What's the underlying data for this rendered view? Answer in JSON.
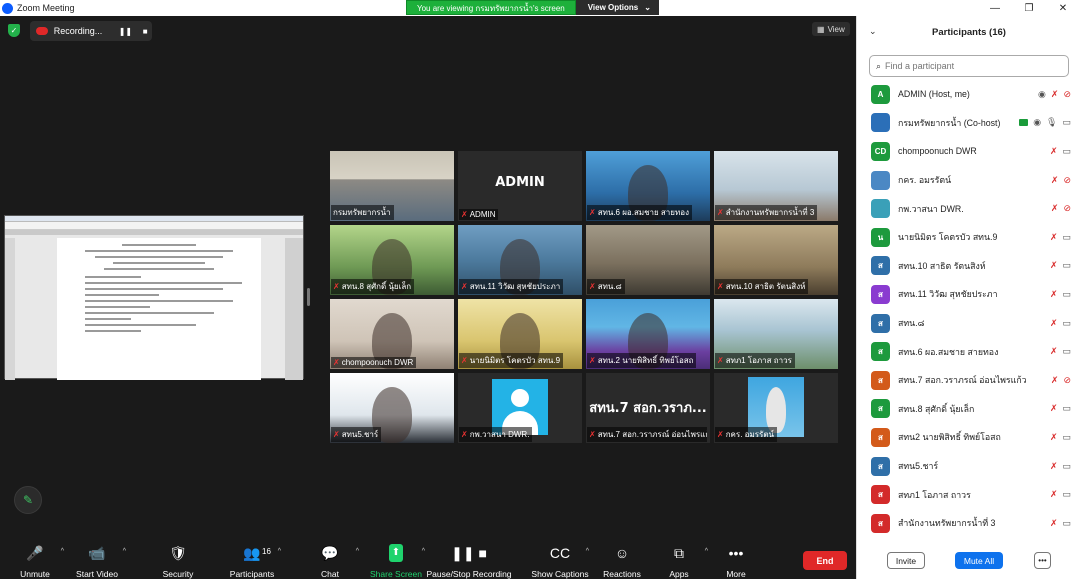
{
  "window": {
    "title": "Zoom Meeting",
    "controls": [
      "—",
      "❐",
      "✕"
    ]
  },
  "share_banner": {
    "message": "You are viewing กรมทรัพยากรน้ำ's screen",
    "options_label": "View Options",
    "options_caret": "⌄"
  },
  "recording": {
    "label": "Recording...",
    "pause_icon": "❚❚",
    "stop_icon": "■"
  },
  "view_button": {
    "icon": "▦",
    "label": "View"
  },
  "video_tiles": [
    {
      "name": "กรมทรัพยากรน้ำ",
      "muted": false,
      "active": true,
      "scene": "meeting-room"
    },
    {
      "name": "ADMIN",
      "muted": true,
      "active": false,
      "scene": "text",
      "big_text": "ADMIN"
    },
    {
      "name": "สทน.6 ผอ.สมชาย สายทอง",
      "muted": true,
      "active": false,
      "scene": "person-blue"
    },
    {
      "name": "สำนักงานทรัพยากรน้ำที่ 3",
      "muted": true,
      "active": false,
      "scene": "office"
    },
    {
      "name": "สทน.8 สุศักดิ์ นุ้ยเล็ก",
      "muted": true,
      "active": false,
      "scene": "person-green"
    },
    {
      "name": "สทน.11 วิวัฒ สุหชัยประภา",
      "muted": true,
      "active": false,
      "scene": "person-lake"
    },
    {
      "name": "สทน.๘",
      "muted": true,
      "active": false,
      "scene": "room"
    },
    {
      "name": "สทน.10 สาธิต รัตนสิงห์",
      "muted": true,
      "active": false,
      "scene": "office2"
    },
    {
      "name": "chompoonuch DWR",
      "muted": true,
      "active": false,
      "scene": "person-female"
    },
    {
      "name": "นายนิมิตร โคตรบัว สทน.9",
      "muted": true,
      "active": false,
      "scene": "person-yellow"
    },
    {
      "name": "สทน.2 นายพิสิทธิ์ ทิพย์โอสถ",
      "muted": true,
      "active": false,
      "scene": "person-purple"
    },
    {
      "name": "สทภ1 โอภาส ถาวร",
      "muted": true,
      "active": false,
      "scene": "aerial"
    },
    {
      "name": "สทน5.ชาร์",
      "muted": true,
      "active": false,
      "scene": "person-dark"
    },
    {
      "name": "กพ.วาสนา DWR.",
      "muted": true,
      "active": false,
      "scene": "avatar"
    },
    {
      "name": "สทน.7 สอก.วราภรณ์ อ่อนไพรแก้ว",
      "muted": true,
      "active": false,
      "scene": "text",
      "big_text": "สทน.7 สอก.วราภ..."
    },
    {
      "name": "กคร. อมรรัตน์",
      "muted": true,
      "active": false,
      "scene": "person-photo"
    }
  ],
  "toolbar": {
    "items": [
      {
        "key": "unmute",
        "label": "Unmute",
        "icon": "🎤",
        "caret": "^"
      },
      {
        "key": "start-video",
        "label": "Start Video",
        "icon": "📹",
        "caret": "^"
      },
      {
        "key": "security",
        "label": "Security",
        "icon": "🛡",
        "caret": ""
      },
      {
        "key": "participants",
        "label": "Participants",
        "icon": "👥",
        "count": "16",
        "caret": "^"
      },
      {
        "key": "chat",
        "label": "Chat",
        "icon": "💬",
        "caret": "^"
      },
      {
        "key": "share-screen",
        "label": "Share Screen",
        "icon": "⬆",
        "caret": "^"
      },
      {
        "key": "pause-stop-recording",
        "label": "Pause/Stop Recording",
        "icon": "❚❚ ■",
        "caret": ""
      },
      {
        "key": "show-captions",
        "label": "Show Captions",
        "icon": "CC",
        "caret": "^"
      },
      {
        "key": "reactions",
        "label": "Reactions",
        "icon": "☺",
        "caret": ""
      },
      {
        "key": "apps",
        "label": "Apps",
        "icon": "⧉",
        "caret": "^"
      },
      {
        "key": "more",
        "label": "More",
        "icon": "•••",
        "caret": ""
      }
    ],
    "end_label": "End"
  },
  "participants_panel": {
    "title": "Participants (16)",
    "search_placeholder": "Find a participant",
    "participants": [
      {
        "initials": "A",
        "name": "ADMIN (Host, me)",
        "color": "#1d9a3d",
        "mic": "off",
        "cam": "off",
        "rec": true,
        "cohost": false
      },
      {
        "initials": "",
        "name": "กรมทรัพยากรน้ำ (Co-host)",
        "color": "#2b6fb8",
        "mic": "on",
        "cam": "on",
        "rec": true,
        "cohost": true
      },
      {
        "initials": "CD",
        "name": "chompoonuch DWR",
        "color": "#1d9a3d",
        "mic": "off",
        "cam": "on",
        "rec": false,
        "cohost": false
      },
      {
        "initials": "",
        "name": "กคร. อมรรัตน์",
        "color": "#4b88c4",
        "mic": "off",
        "cam": "off",
        "rec": false,
        "cohost": false
      },
      {
        "initials": "",
        "name": "กพ.วาสนา DWR.",
        "color": "#3aa0b8",
        "mic": "off",
        "cam": "off",
        "rec": false,
        "cohost": false
      },
      {
        "initials": "น",
        "name": "นายนิมิตร โคตรบัว สทน.9",
        "color": "#1d9a3d",
        "mic": "off",
        "cam": "on",
        "rec": false,
        "cohost": false
      },
      {
        "initials": "ส",
        "name": "สทน.10 สาธิต รัตนสิงห์",
        "color": "#2f6fa8",
        "mic": "off",
        "cam": "on",
        "rec": false,
        "cohost": false
      },
      {
        "initials": "ส",
        "name": "สทน.11 วิวัฒ สุหชัยประภา",
        "color": "#8a3bd0",
        "mic": "off",
        "cam": "on",
        "rec": false,
        "cohost": false
      },
      {
        "initials": "ส",
        "name": "สทน.๘",
        "color": "#2f6fa8",
        "mic": "off",
        "cam": "on",
        "rec": false,
        "cohost": false
      },
      {
        "initials": "ส",
        "name": "สทน.6 ผอ.สมชาย สายทอง",
        "color": "#1d9a3d",
        "mic": "off",
        "cam": "on",
        "rec": false,
        "cohost": false
      },
      {
        "initials": "ส",
        "name": "สทน.7 สอก.วราภรณ์ อ่อนไพรแก้ว",
        "color": "#d35a1a",
        "mic": "off",
        "cam": "off",
        "rec": false,
        "cohost": false
      },
      {
        "initials": "ส",
        "name": "สทน.8 สุศักดิ์ นุ้ยเล็ก",
        "color": "#1d9a3d",
        "mic": "off",
        "cam": "on",
        "rec": false,
        "cohost": false
      },
      {
        "initials": "ส",
        "name": "สทน2 นายพิสิทธิ์ ทิพย์โอสถ",
        "color": "#d35a1a",
        "mic": "off",
        "cam": "on",
        "rec": false,
        "cohost": false
      },
      {
        "initials": "ส",
        "name": "สทน5.ชาร์",
        "color": "#2f6fa8",
        "mic": "off",
        "cam": "on",
        "rec": false,
        "cohost": false
      },
      {
        "initials": "ส",
        "name": "สทภ1 โอภาส ถาวร",
        "color": "#d32a2a",
        "mic": "off",
        "cam": "on",
        "rec": false,
        "cohost": false
      },
      {
        "initials": "ส",
        "name": "สำนักงานทรัพยากรน้ำที่ 3",
        "color": "#d32a2a",
        "mic": "off",
        "cam": "on",
        "rec": false,
        "cohost": false
      }
    ],
    "invite_label": "Invite",
    "mute_all_label": "Mute All",
    "more_label": "•••"
  },
  "colors": {
    "background": "#1a1a1a",
    "banner_green": "#1db03b",
    "end_red": "#e02828",
    "mute_all_blue": "#0e72ed",
    "active_speaker": "#e8e02a"
  }
}
